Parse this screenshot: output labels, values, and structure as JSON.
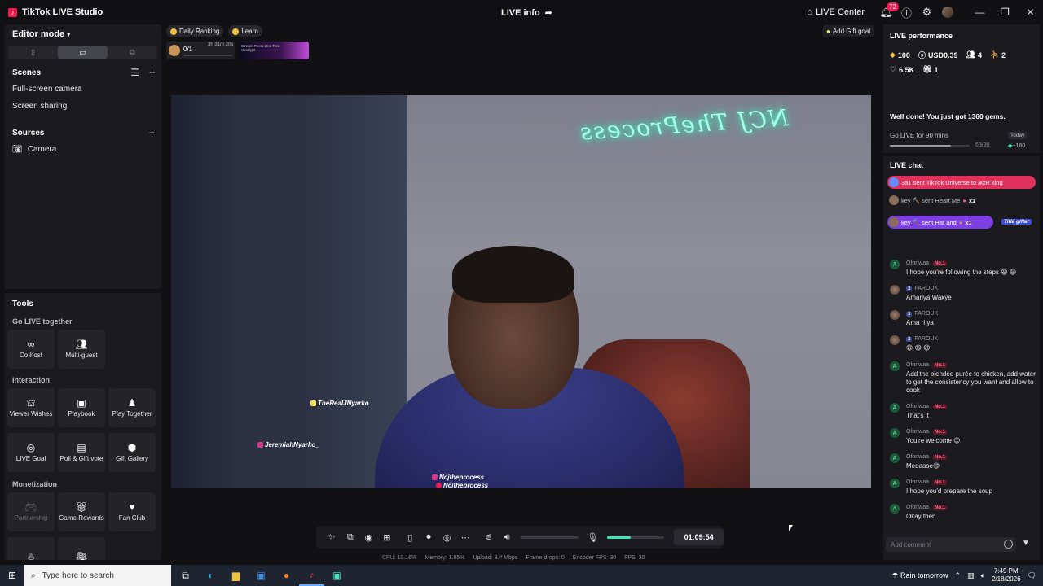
{
  "app": {
    "title": "TikTok LIVE Studio",
    "live_info": "LIVE info",
    "live_center": "LIVE Center",
    "notifications_count": "72"
  },
  "editor": {
    "mode_label": "Editor mode",
    "scenes_title": "Scenes",
    "scenes": [
      "Full-screen camera",
      "Screen sharing"
    ],
    "sources_title": "Sources",
    "sources": [
      "Camera"
    ]
  },
  "tools": {
    "title": "Tools",
    "categories": {
      "go_live_together": "Go LIVE together",
      "interaction": "Interaction",
      "monetization": "Monetization"
    },
    "items": {
      "cohost": "Co-host",
      "multiguest": "Multi-guest",
      "viewer_wishes": "Viewer Wishes",
      "playbook": "Playbook",
      "play_together": "Play Together",
      "live_goal": "LIVE Goal",
      "poll_gift_vote": "Poll & Gift vote",
      "gift_gallery": "Gift Gallery",
      "partnership": "Partnership",
      "game_rewards": "Game Rewards",
      "fan_club": "Fan Club"
    }
  },
  "top": {
    "daily_ranking": "Daily Ranking",
    "learn": "Learn",
    "rank_count": "0/1",
    "rank_time": "3h 31m 20s",
    "banner_text": "Stream Peers One Tree Spotlight",
    "add_gift_goal": "Add Gift goal"
  },
  "preview": {
    "neon_sign": "NCJ TheProcess",
    "tags": {
      "tag1": "TheRealJNyarko",
      "tag2": "JeremiahNyarko_",
      "tag3": "Ncjtheprocess",
      "tag4": "Ncjtheprocess"
    }
  },
  "controls": {
    "timer": "01:09:54",
    "mic_level": 0.42
  },
  "stats": {
    "cpu": "CPU:  10.16%",
    "memory": "Memory:  1.85%",
    "upload": "Upload:  3.4 Mbps",
    "frame_drops": "Frame drops:  0",
    "encoder_fps": "Encoder FPS:  30",
    "fps": "FPS:  30"
  },
  "performance": {
    "title": "LIVE performance",
    "diamonds": "100",
    "usd": "USD0.39",
    "users": "4",
    "viewers": "2",
    "likes": "6.5K",
    "gifts": "1",
    "gems_message": "Well done! You just got 1360 gems.",
    "go_live_task": "Go LIVE for 90 mins",
    "today": "Today",
    "progress_label": "69/90",
    "progress_fraction": 0.77,
    "reward": "+160"
  },
  "chat": {
    "title": "LIVE chat",
    "gifts": [
      {
        "text": "3a1 sent TikTok Universe to ʍxR king ︎ ️ ︎"
      },
      {
        "text": "key 🔨 sent Heart Me",
        "count": "x1"
      },
      {
        "text": "key 🔨 sent Hat and",
        "count": "x1",
        "badge": "Title gifter"
      }
    ],
    "messages": [
      {
        "avatar": "A",
        "name": "Oforiwaa ︎",
        "rank": "No.1",
        "text": "I hope you're following the steps 😆 😆"
      },
      {
        "avatar": "",
        "name": "FAROUK",
        "level": "3",
        "text": "Amariya Wakye"
      },
      {
        "avatar": "",
        "name": "FAROUK",
        "level": "3",
        "text": "Ama ri ya"
      },
      {
        "avatar": "",
        "name": "FAROUK",
        "level": "3",
        "text": "😆 😆 😆"
      },
      {
        "avatar": "A",
        "name": "Oforiwaa ︎",
        "rank": "No.1",
        "text": "Add the blended purée to chicken, add water to get the consistency you want and allow to cook"
      },
      {
        "avatar": "A",
        "name": "Oforiwaa ︎",
        "rank": "No.1",
        "text": "That's it"
      },
      {
        "avatar": "A",
        "name": "Oforiwaa ︎",
        "rank": "No.1",
        "text": "You're welcome 😊"
      },
      {
        "avatar": "A",
        "name": "Oforiwaa ︎",
        "rank": "No.1",
        "text": "Medaase😊"
      },
      {
        "avatar": "A",
        "name": "Oforiwaa ︎",
        "rank": "No.1",
        "text": "I hope you'd prepare the soup"
      },
      {
        "avatar": "A",
        "name": "Oforiwaa ︎",
        "rank": "No.1",
        "text": "Okay then"
      }
    ],
    "comment_placeholder": "Add comment"
  },
  "taskbar": {
    "search_placeholder": "Type here to search",
    "weather": "Rain tomorrow",
    "time": "7:49 PM",
    "date": "2/18/2026"
  },
  "colors": {
    "accent_pink": "#ee1d52",
    "mic_green": "#3ee6b8",
    "gift_pink": "#e0305c",
    "gift_purple": "#7b3fe4"
  }
}
